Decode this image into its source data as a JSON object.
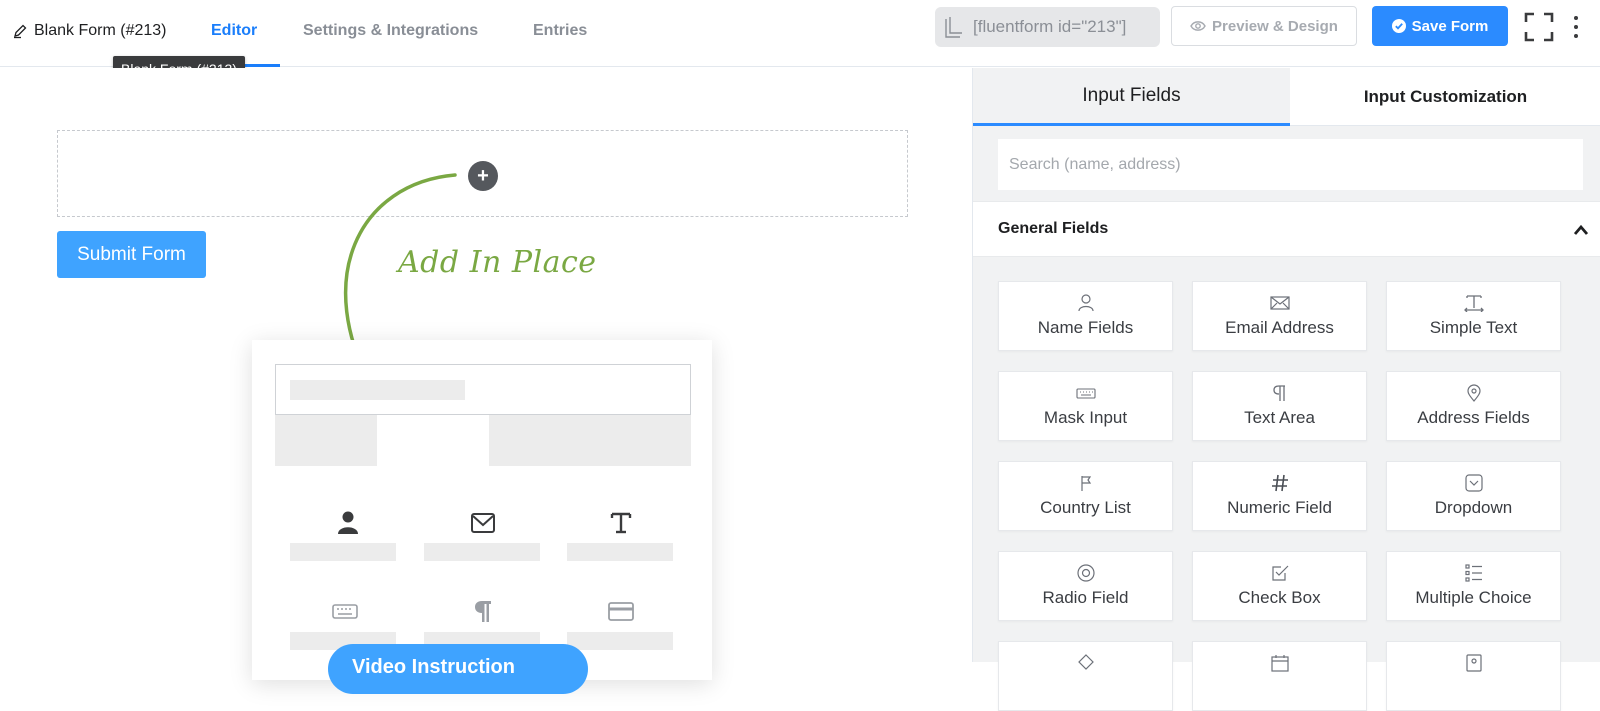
{
  "header": {
    "form_title": "Blank Form (#213)",
    "tabs": [
      {
        "label": "Editor",
        "active": true
      },
      {
        "label": "Settings & Integrations",
        "active": false
      },
      {
        "label": "Entries",
        "active": false
      }
    ],
    "tooltip": "Blank Form (#213)",
    "shortcode": "[fluentform id=\"213\"]",
    "preview_label": "Preview & Design",
    "save_label": "Save Form",
    "accent_color": "#2b8bff"
  },
  "editor": {
    "submit_label": "Submit Form",
    "annotation": "Add In Place",
    "video_label": "Video Instruction",
    "annotation_color": "#7aa843"
  },
  "panel": {
    "tabs": [
      {
        "label": "Input Fields",
        "active": true
      },
      {
        "label": "Input Customization",
        "active": false
      }
    ],
    "search_placeholder": "Search (name, address)",
    "section_title": "General Fields",
    "fields": [
      {
        "label": "Name Fields",
        "icon": "user-icon"
      },
      {
        "label": "Email Address",
        "icon": "envelope-icon"
      },
      {
        "label": "Simple Text",
        "icon": "text-icon"
      },
      {
        "label": "Mask Input",
        "icon": "keyboard-icon"
      },
      {
        "label": "Text Area",
        "icon": "paragraph-icon"
      },
      {
        "label": "Address Fields",
        "icon": "map-pin-icon"
      },
      {
        "label": "Country List",
        "icon": "flag-icon"
      },
      {
        "label": "Numeric Field",
        "icon": "hash-icon"
      },
      {
        "label": "Dropdown",
        "icon": "dropdown-icon"
      },
      {
        "label": "Radio Field",
        "icon": "radio-icon"
      },
      {
        "label": "Check Box",
        "icon": "checkbox-icon"
      },
      {
        "label": "Multiple Choice",
        "icon": "list-icon"
      }
    ]
  }
}
